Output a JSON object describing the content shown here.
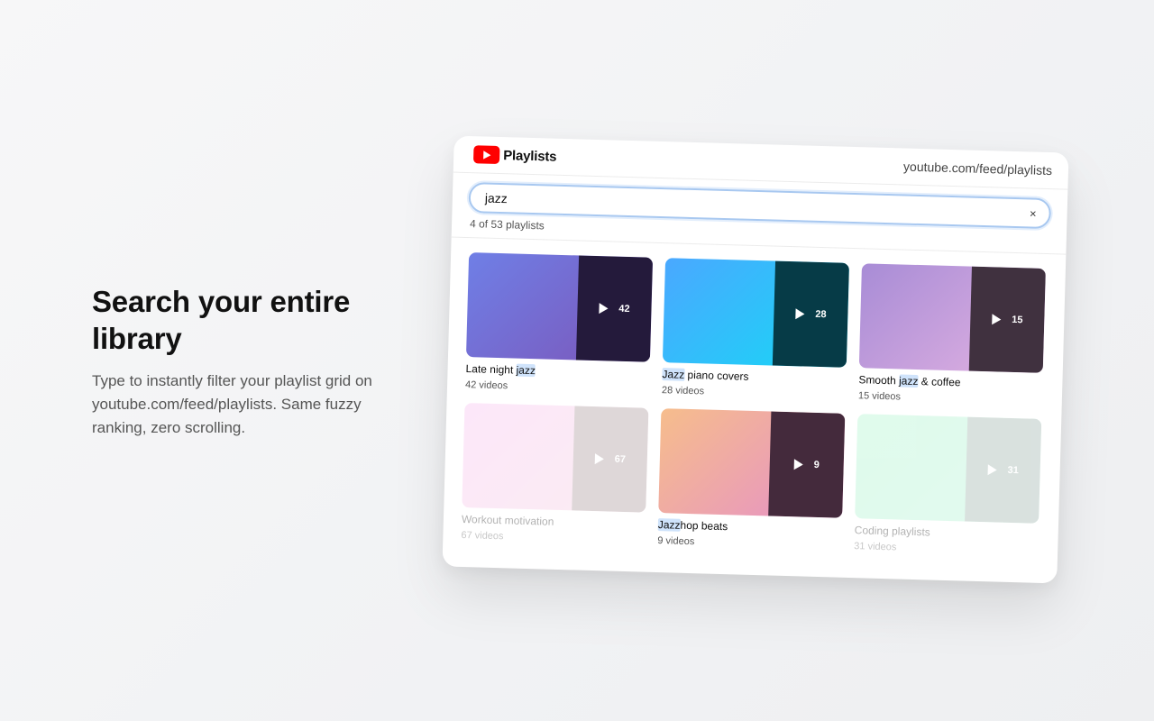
{
  "hero": {
    "title": "Search your entire library",
    "description": "Type to instantly filter your playlist grid on youtube.com/feed/playlists. Same fuzzy ranking, zero scrolling."
  },
  "header": {
    "logo_icon": "youtube-play-icon",
    "title": "Playlists",
    "url": "youtube.com/feed/playlists"
  },
  "search": {
    "value": "jazz",
    "placeholder": "",
    "clear_label": "×",
    "result_count": "4 of 53 playlists"
  },
  "colors": {
    "brand_red": "#ff0000",
    "highlight": "#cfe3fb",
    "focus_ring": "#a8c8f0"
  },
  "playlists": [
    {
      "title_pre": "Late night ",
      "title_match": "jazz",
      "title_post": "",
      "subtitle": "42 videos",
      "count": "42",
      "matched": true,
      "gradient": "linear-gradient(135deg, #6f7fe6 0%, #7c55b8 100%)",
      "overlay": "#241a3b"
    },
    {
      "title_pre": "",
      "title_match": "Jazz",
      "title_post": " piano covers",
      "subtitle": "28 videos",
      "count": "28",
      "matched": true,
      "gradient": "linear-gradient(135deg, #4aa8ff 0%, #16d9f5 100%)",
      "overlay": "#063b47"
    },
    {
      "title_pre": "Smooth ",
      "title_match": "jazz",
      "title_post": " & coffee",
      "subtitle": "15 videos",
      "count": "15",
      "matched": true,
      "gradient": "linear-gradient(135deg, #a88cd6 0%, #e3b3e2 100%)",
      "overlay": "#40313f"
    },
    {
      "title_pre": "Workout motivation",
      "title_match": "",
      "title_post": "",
      "subtitle": "67 videos",
      "count": "67",
      "matched": false,
      "gradient": "linear-gradient(135deg, #f7b7ef 0%, #f3c6d8 100%)",
      "overlay": "#9a8588"
    },
    {
      "title_pre": "",
      "title_match": "Jazz",
      "title_post": "hop beats",
      "subtitle": "9 videos",
      "count": "9",
      "matched": true,
      "gradient": "linear-gradient(135deg, #f6bd8c 0%, #e58fc9 100%)",
      "overlay": "#442a3c"
    },
    {
      "title_pre": "Coding playlists",
      "title_match": "",
      "title_post": "",
      "subtitle": "31 videos",
      "count": "31",
      "matched": false,
      "gradient": "linear-gradient(135deg, #9cf2c2 0%, #a9f0d2 100%)",
      "overlay": "#8aa39b"
    }
  ]
}
